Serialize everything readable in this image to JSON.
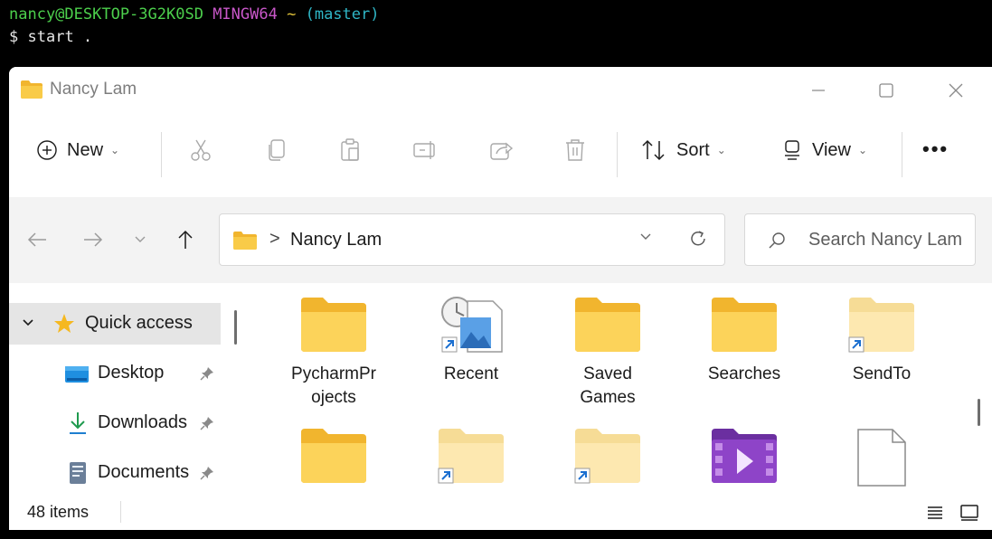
{
  "terminal": {
    "user_host": "nancy@DESKTOP-3G2K0SD",
    "system": "MINGW64",
    "cwd": "~",
    "branch": "(master)",
    "prompt": "$",
    "command": "start ."
  },
  "window": {
    "title": "Nancy Lam"
  },
  "toolbar": {
    "new_label": "New",
    "sort_label": "Sort",
    "view_label": "View"
  },
  "address_bar": {
    "separator": ">",
    "location": "Nancy Lam"
  },
  "search": {
    "placeholder": "Search Nancy Lam"
  },
  "sidebar": {
    "items": [
      {
        "label": "Quick access"
      },
      {
        "label": "Desktop"
      },
      {
        "label": "Downloads"
      },
      {
        "label": "Documents"
      }
    ]
  },
  "content": {
    "items": [
      {
        "label": "PycharmPr ojects",
        "icon": "folder-icon"
      },
      {
        "label": "Recent",
        "icon": "recent-shortcut-icon"
      },
      {
        "label": "Saved Games",
        "icon": "folder-icon"
      },
      {
        "label": "Searches",
        "icon": "folder-icon"
      },
      {
        "label": "SendTo",
        "icon": "folder-shortcut-icon"
      },
      {
        "label": "",
        "icon": "folder-icon"
      },
      {
        "label": "",
        "icon": "folder-shortcut-icon"
      },
      {
        "label": "",
        "icon": "folder-shortcut-icon"
      },
      {
        "label": "",
        "icon": "videos-folder-icon"
      },
      {
        "label": "",
        "icon": "file-icon"
      }
    ]
  },
  "status": {
    "item_count": "48 items"
  },
  "colors": {
    "terminal_bg": "#000000",
    "user_green": "#4ccf4c",
    "system_magenta": "#c957c9",
    "branch_cyan": "#2fb6c6",
    "folder_yellow": "#f8c941",
    "selection_gray": "#e5e5e5",
    "nav_bg": "#f3f3f3"
  }
}
